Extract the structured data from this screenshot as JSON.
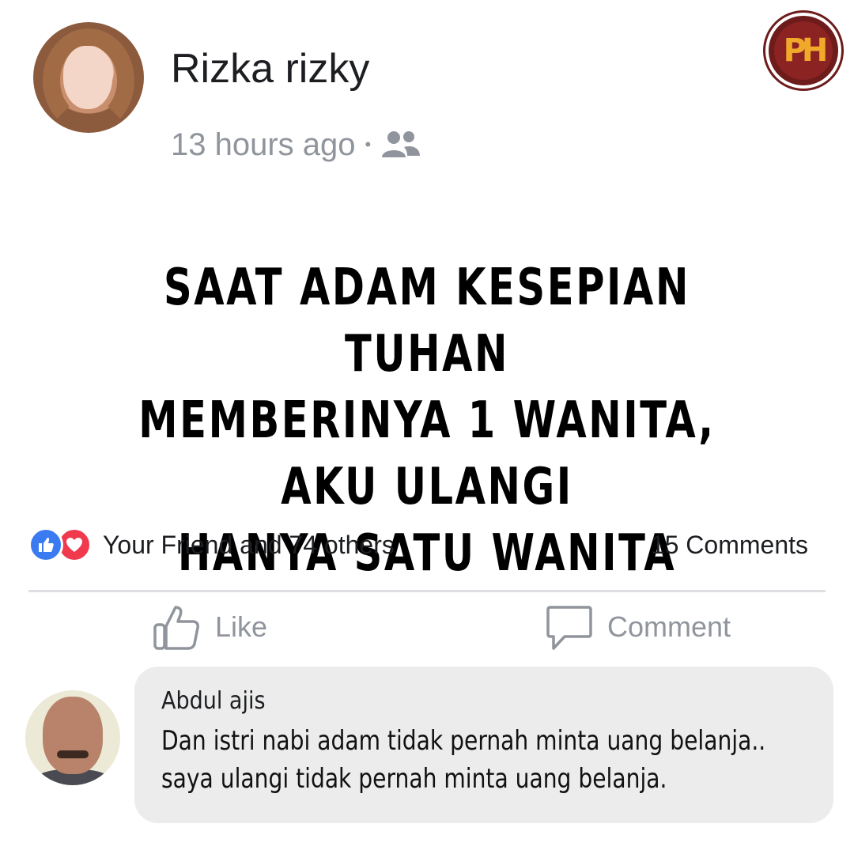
{
  "post": {
    "author": "Rizka rizky",
    "time": "13 hours ago",
    "separator": "•",
    "audience_icon": "friends-icon",
    "text_lines": [
      "SAAT ADAM KESEPIAN TUHAN",
      "MEMBERINYA 1 WANITA, AKU ULANGI",
      "HANYA SATU WANITA"
    ]
  },
  "watermark": {
    "logo_text": "PH",
    "colors": {
      "ring": "#6e1b1b",
      "letters": "#f1a92a"
    }
  },
  "reactions": {
    "icons": [
      "like-icon",
      "love-icon"
    ],
    "summary": "Your Friend and 74 others",
    "comments_count": "15 Comments"
  },
  "actions": {
    "like_label": "Like",
    "comment_label": "Comment"
  },
  "comment": {
    "author": "Abdul ajis",
    "text_lines": [
      "Dan istri nabi adam tidak pernah minta uang belanja..",
      "saya ulangi tidak pernah minta uang belanja."
    ]
  },
  "colors": {
    "like_blue": "#3b7bf2",
    "love_red": "#f0394d",
    "meta_gray": "#90949c",
    "bubble_bg": "#ececec"
  }
}
